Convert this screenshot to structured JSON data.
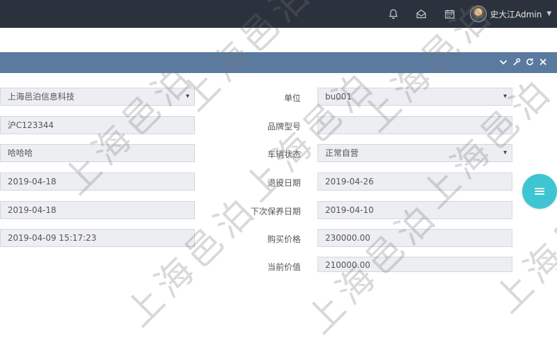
{
  "header": {
    "user_name": "史大江Admin"
  },
  "icons": {
    "bell": "bell-icon",
    "mail": "mail-icon",
    "calendar": "calendar-icon",
    "caret": "chevron-down-icon"
  },
  "panel": {
    "tools": [
      "chevron-down-icon",
      "wrench-icon",
      "refresh-icon",
      "close-icon"
    ]
  },
  "form": {
    "left": [
      {
        "value": "上海邑泊信息科技",
        "type": "select"
      },
      {
        "value": "沪C123344",
        "type": "text"
      },
      {
        "value": "哈哈哈",
        "type": "text"
      },
      {
        "value": "2019-04-18",
        "type": "text"
      },
      {
        "value": "2019-04-18",
        "type": "text"
      },
      {
        "value": "2019-04-09 15:17:23",
        "type": "text"
      }
    ],
    "right": [
      {
        "label": "单位",
        "value": "bu001",
        "type": "select"
      },
      {
        "label": "品牌型号",
        "value": "",
        "type": "text"
      },
      {
        "label": "车辆状态",
        "value": "正常自营",
        "type": "select"
      },
      {
        "label": "退役日期",
        "value": "2019-04-26",
        "type": "text"
      },
      {
        "label": "下次保养日期",
        "value": "2019-04-10",
        "type": "text"
      },
      {
        "label": "购买价格",
        "value": "230000.00",
        "type": "text"
      },
      {
        "label": "当前价值",
        "value": "210000.00",
        "type": "text"
      }
    ]
  },
  "watermark": {
    "text": "上海邑泊"
  },
  "colors": {
    "topbar": "#2b323d",
    "panel_header": "#5b7aa0",
    "fab": "#3ec5d2",
    "field_bg": "#eceef2"
  }
}
